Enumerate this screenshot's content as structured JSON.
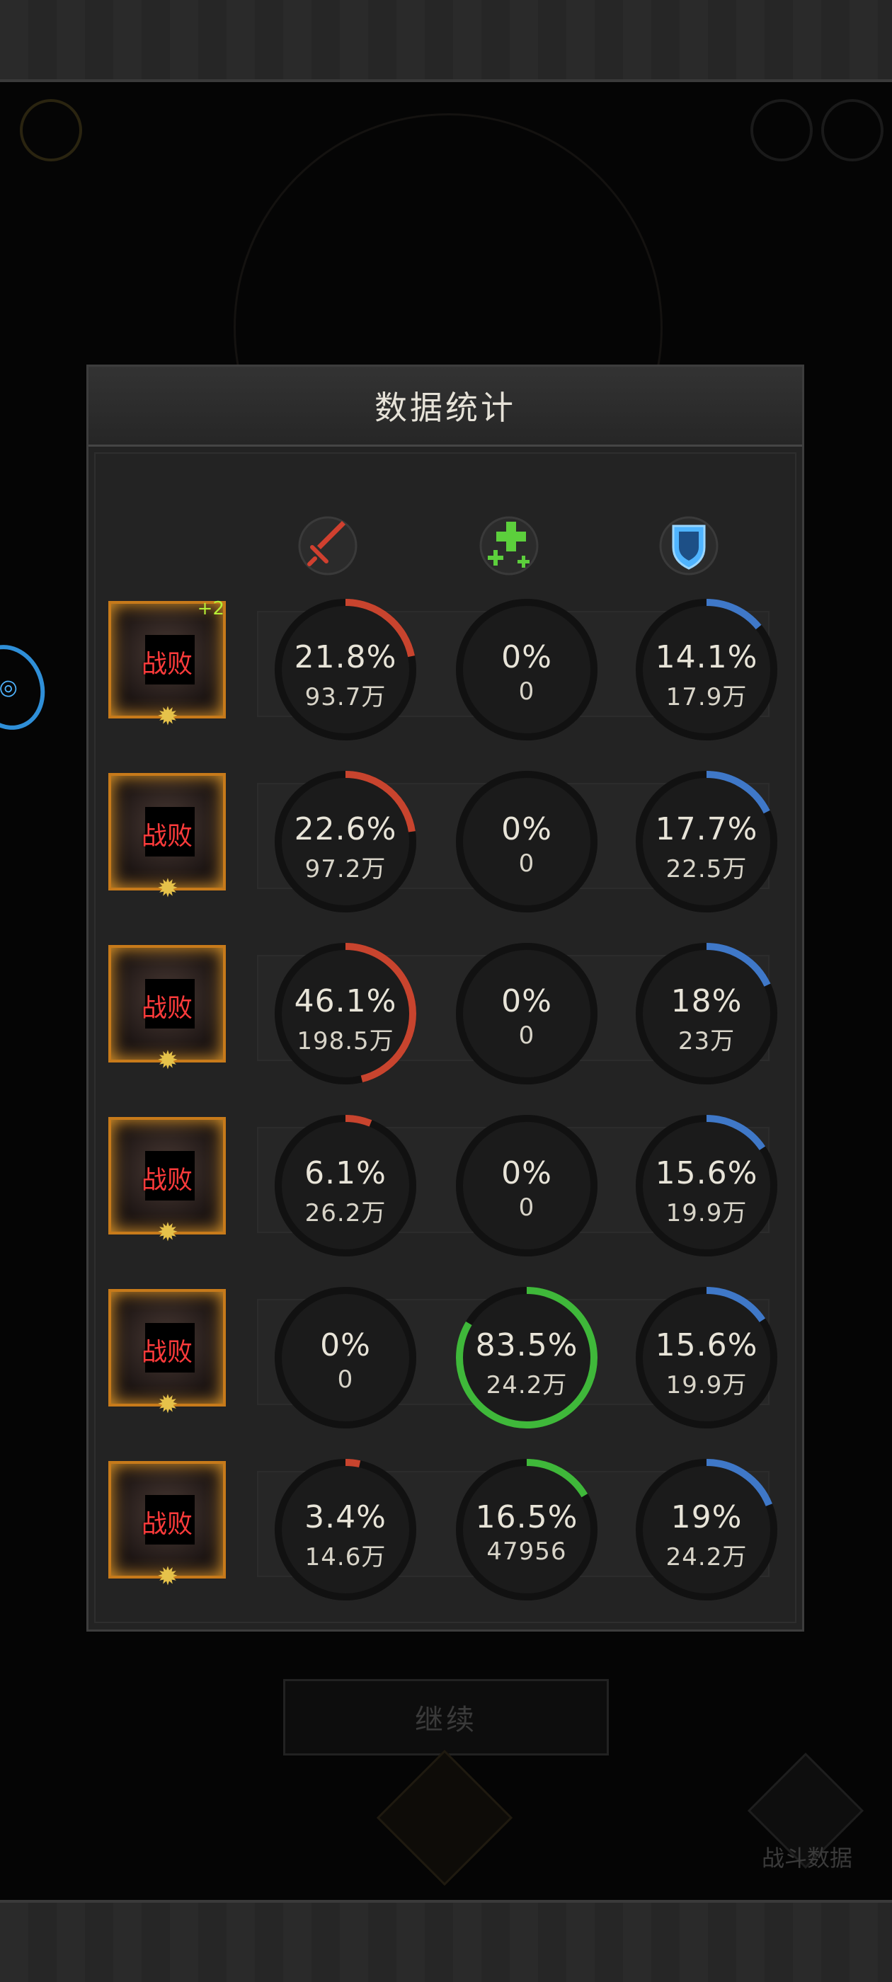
{
  "dialog": {
    "title": "数据统计"
  },
  "stat_headers": [
    {
      "icon": "sword-icon",
      "color": "#d0402f"
    },
    {
      "icon": "heal-cross-icon",
      "color": "#5ccf3c"
    },
    {
      "icon": "shield-icon",
      "color": "#4fb4ff"
    }
  ],
  "heroes": [
    {
      "status": "战败",
      "badge": "+2",
      "damage": {
        "percent": "21.8%",
        "amount": "93.7万",
        "fraction": 0.218
      },
      "heal": {
        "percent": "0%",
        "amount": "0",
        "fraction": 0
      },
      "tank": {
        "percent": "14.1%",
        "amount": "17.9万",
        "fraction": 0.141
      }
    },
    {
      "status": "战败",
      "badge": "",
      "damage": {
        "percent": "22.6%",
        "amount": "97.2万",
        "fraction": 0.226
      },
      "heal": {
        "percent": "0%",
        "amount": "0",
        "fraction": 0
      },
      "tank": {
        "percent": "17.7%",
        "amount": "22.5万",
        "fraction": 0.177
      }
    },
    {
      "status": "战败",
      "badge": "",
      "damage": {
        "percent": "46.1%",
        "amount": "198.5万",
        "fraction": 0.461
      },
      "heal": {
        "percent": "0%",
        "amount": "0",
        "fraction": 0
      },
      "tank": {
        "percent": "18%",
        "amount": "23万",
        "fraction": 0.18
      }
    },
    {
      "status": "战败",
      "badge": "",
      "damage": {
        "percent": "6.1%",
        "amount": "26.2万",
        "fraction": 0.061
      },
      "heal": {
        "percent": "0%",
        "amount": "0",
        "fraction": 0
      },
      "tank": {
        "percent": "15.6%",
        "amount": "19.9万",
        "fraction": 0.156
      }
    },
    {
      "status": "战败",
      "badge": "",
      "damage": {
        "percent": "0%",
        "amount": "0",
        "fraction": 0
      },
      "heal": {
        "percent": "83.5%",
        "amount": "24.2万",
        "fraction": 0.835
      },
      "tank": {
        "percent": "15.6%",
        "amount": "19.9万",
        "fraction": 0.156
      }
    },
    {
      "status": "战败",
      "badge": "",
      "damage": {
        "percent": "3.4%",
        "amount": "14.6万",
        "fraction": 0.034
      },
      "heal": {
        "percent": "16.5%",
        "amount": "47956",
        "fraction": 0.165
      },
      "tank": {
        "percent": "19%",
        "amount": "24.2万",
        "fraction": 0.19
      }
    }
  ],
  "colors": {
    "damage_ring": "#c8442e",
    "heal_ring": "#3fb83a",
    "tank_ring": "#3f78c8",
    "defeat_text": "#ff3b3b"
  },
  "footer": {
    "continue_label": "继续",
    "battle_data_label": "战斗数据"
  }
}
